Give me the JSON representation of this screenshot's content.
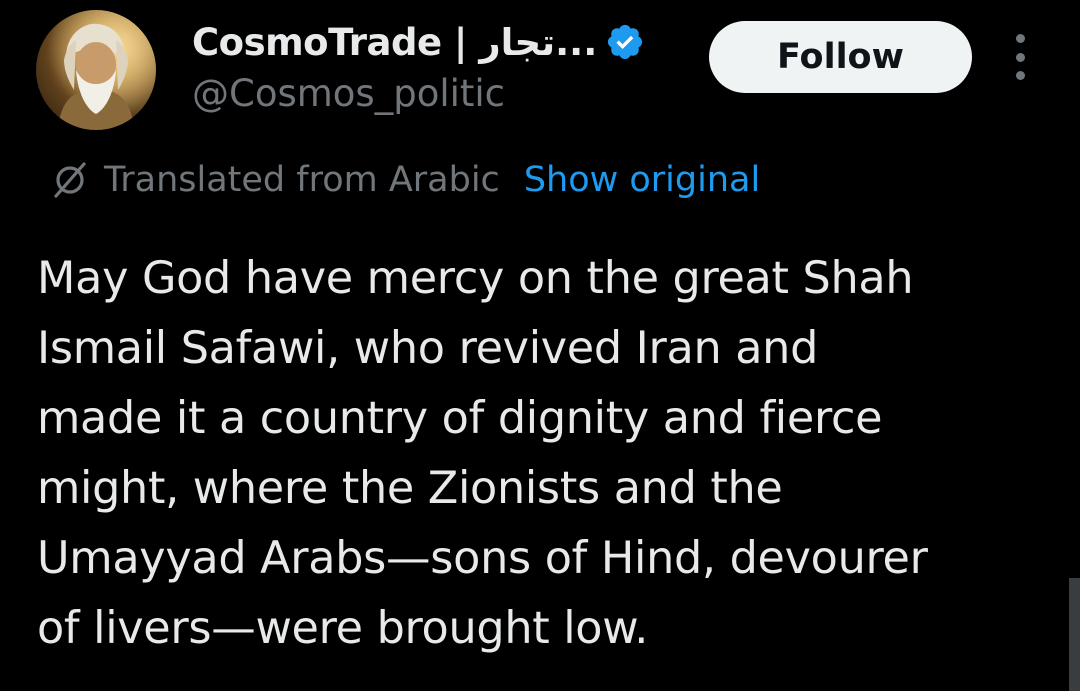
{
  "author": {
    "display_name": "CosmoTrade | تجار...",
    "handle": "@Cosmos_politic",
    "avatar_icon": "portrait-avatar",
    "verified_icon": "verified-badge-icon",
    "verified_color": "#1d9bf0"
  },
  "actions": {
    "follow_label": "Follow",
    "more_icon": "more-options-icon"
  },
  "translation": {
    "icon": "translate-icon",
    "label": "Translated from Arabic",
    "show_original_label": "Show original",
    "link_color": "#1d9bf0"
  },
  "tweet": {
    "lines": [
      "May God have mercy on the great Shah",
      "Ismail Safawi, who revived Iran and",
      "made it a country of dignity and fierce",
      "might, where the Zionists and the",
      "Umayyad Arabs—sons of Hind, devourer",
      "of livers—were brought low."
    ]
  },
  "colors": {
    "background": "#000000",
    "primary_text": "#e7e9ea",
    "secondary_text": "#71767b",
    "button_bg": "#eff3f4"
  }
}
